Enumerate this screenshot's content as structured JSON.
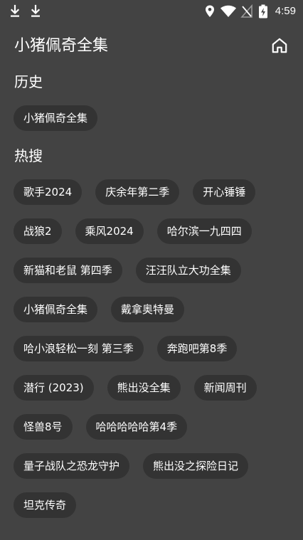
{
  "status_bar": {
    "time": "4:59",
    "left_icons": [
      "download-icon",
      "download-icon"
    ],
    "right_icons": [
      "location-icon",
      "wifi-icon",
      "no-signal-icon",
      "battery-charging-icon"
    ]
  },
  "header": {
    "title": "小猪佩奇全集",
    "home_icon": "home-icon"
  },
  "history": {
    "title": "历史",
    "items": [
      "小猪佩奇全集"
    ]
  },
  "hot": {
    "title": "热搜",
    "items": [
      "歌手2024",
      "庆余年第二季",
      "开心锤锤",
      "战狼2",
      "乘风2024",
      "哈尔滨一九四四",
      "新猫和老鼠 第四季",
      "汪汪队立大功全集",
      "小猪佩奇全集",
      "戴拿奥特曼",
      "哈小浪轻松一刻 第三季",
      "奔跑吧第8季",
      "潜行 (2023)",
      "熊出没全集",
      "新闻周刊",
      "怪兽8号",
      "哈哈哈哈哈第4季",
      "量子战队之恐龙守护",
      "熊出没之探险日记",
      "坦克传奇"
    ]
  },
  "colors": {
    "background": "#434343",
    "chip": "#333333",
    "text": "#ffffff"
  }
}
